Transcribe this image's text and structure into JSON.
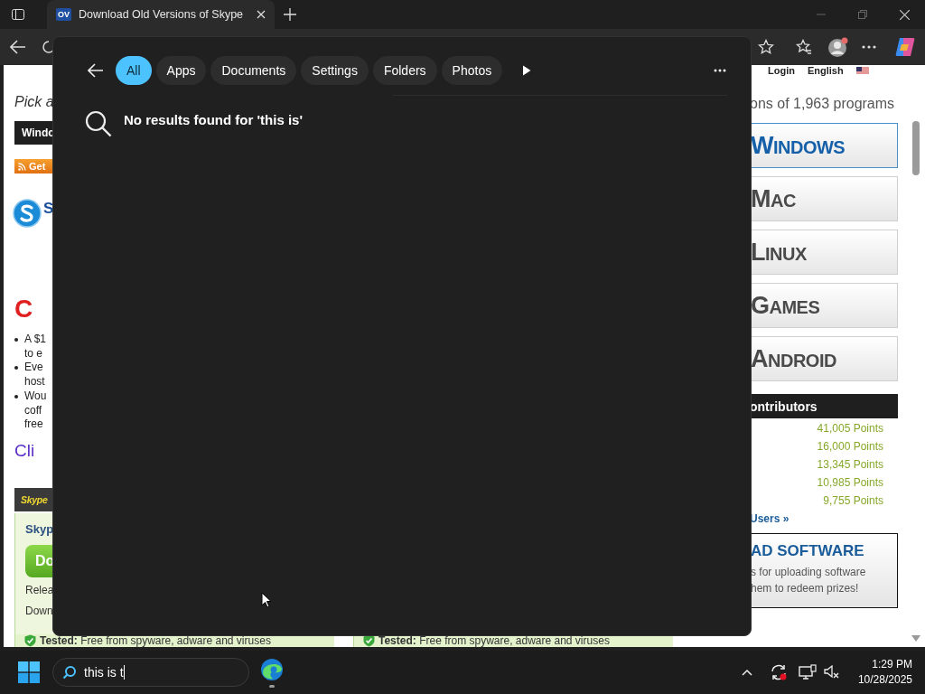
{
  "browser": {
    "tab": {
      "favicon": "OV",
      "title": "Download Old Versions of Skype"
    }
  },
  "page": {
    "nav": [
      "Login",
      "English"
    ],
    "left": {
      "intro": "Pick a",
      "bar": "Windc",
      "rss": "Get",
      "app_initial": "S",
      "headline": "C",
      "bullets": [
        [
          "A $1",
          "to e"
        ],
        [
          "Eve",
          "host"
        ],
        [
          "Wou",
          "coff",
          "free"
        ]
      ],
      "link": "Cli",
      "section": "Skype",
      "product": "Skyp",
      "download": "Do",
      "details": [
        "Relea",
        "Down"
      ]
    },
    "right": {
      "count": "ons of 1,963 programs",
      "platforms": [
        {
          "label": "WINDOWS",
          "selected": true
        },
        {
          "label": "MAC",
          "selected": false
        },
        {
          "label": "LINUX",
          "selected": false
        },
        {
          "label": "GAMES",
          "selected": false
        },
        {
          "label": "ANDROID",
          "selected": false
        }
      ],
      "contributors_title": "ontributors",
      "points": [
        "41,005 Points",
        "16,000 Points",
        "13,345 Points",
        "10,985 Points",
        "9,755 Points"
      ],
      "users_link": "Users »",
      "upload": {
        "title": "AD SOFTWARE",
        "lines": [
          "s for uploading software",
          "hem to redeem prizes!"
        ]
      }
    },
    "tested": [
      "**Tested:** Free from spyware, adware and viruses",
      "**Tested:** Free from spyware, adware and viruses"
    ]
  },
  "search_panel": {
    "filters": [
      {
        "label": "All",
        "selected": true
      },
      {
        "label": "Apps",
        "selected": false
      },
      {
        "label": "Documents",
        "selected": false
      },
      {
        "label": "Settings",
        "selected": false
      },
      {
        "label": "Folders",
        "selected": false
      },
      {
        "label": "Photos",
        "selected": false
      }
    ],
    "message": "No results found for 'this is'"
  },
  "taskbar": {
    "search_value": "this is t",
    "time": "1:29 PM",
    "date": "10/28/2025"
  }
}
